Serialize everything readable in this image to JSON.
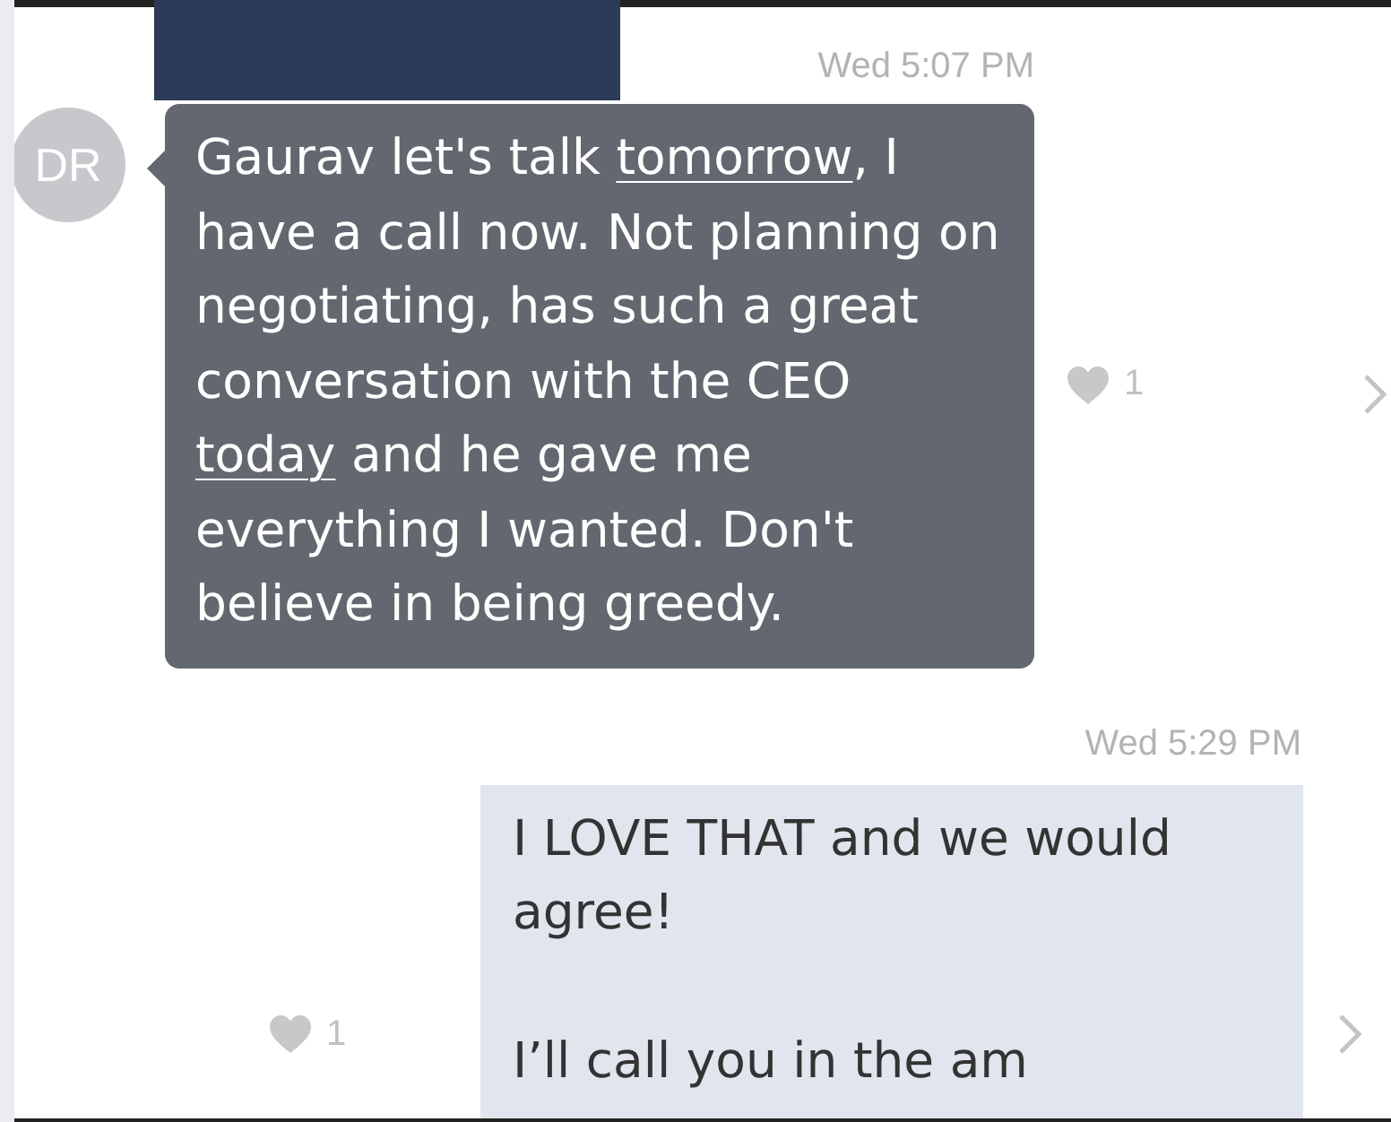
{
  "messages": [
    {
      "kind": "incoming",
      "timestamp": "Wed 5:07 PM",
      "avatar": "DR",
      "segments": [
        {
          "text": "Gaurav let's talk ",
          "link": false
        },
        {
          "text": "tomorrow",
          "link": true
        },
        {
          "text": ", I have a call now. Not planning on negotiating, has such a great conversation with the CEO ",
          "link": false
        },
        {
          "text": "today",
          "link": true
        },
        {
          "text": " and he gave me everything I wanted. Don't believe in being greedy.",
          "link": false
        }
      ],
      "likes": "1"
    },
    {
      "kind": "outgoing",
      "timestamp": "Wed 5:29 PM",
      "paragraphs": [
        "I LOVE THAT and we would agree!",
        "I’ll call you in the am"
      ],
      "likes": "1"
    }
  ]
}
